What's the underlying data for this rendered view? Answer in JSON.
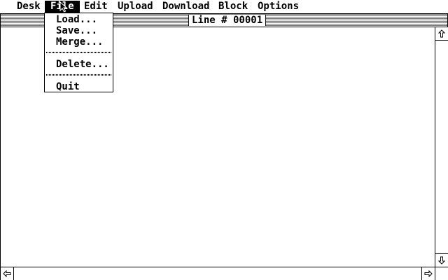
{
  "menubar": {
    "items": [
      {
        "label": "Desk"
      },
      {
        "label": "File"
      },
      {
        "label": "Edit"
      },
      {
        "label": "Upload"
      },
      {
        "label": "Download"
      },
      {
        "label": "Block"
      },
      {
        "label": "Options"
      }
    ]
  },
  "file_menu": {
    "items": [
      {
        "label": "Load..."
      },
      {
        "label": "Save..."
      },
      {
        "label": "Merge..."
      },
      {
        "label": "Delete..."
      },
      {
        "label": "Quit"
      }
    ]
  },
  "window": {
    "title": "Line # 00001"
  },
  "icons": {
    "scroll_up": "up-arrow-icon",
    "scroll_down": "down-arrow-icon",
    "scroll_left": "left-arrow-icon",
    "scroll_right": "right-arrow-icon",
    "pointer": "mouse-pointer-icon"
  },
  "colors": {
    "foreground": "#000000",
    "background": "#ffffff"
  }
}
